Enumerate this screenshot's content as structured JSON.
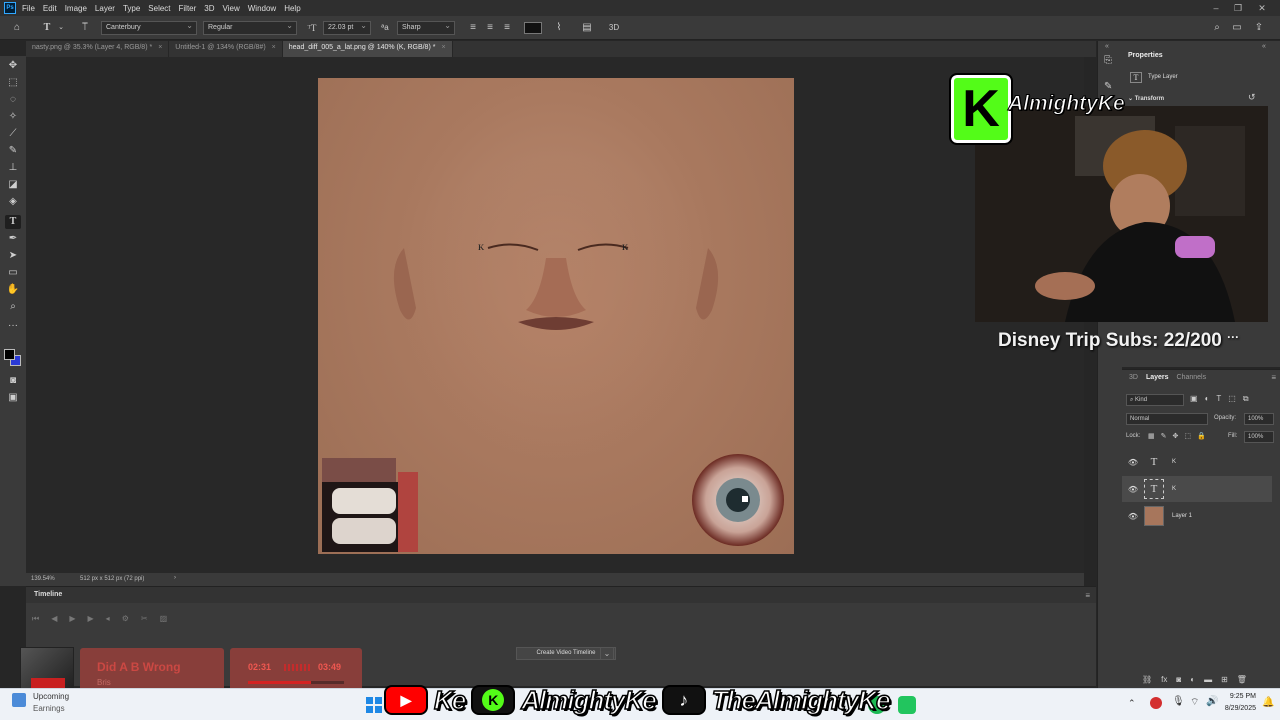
{
  "menubar": {
    "items": [
      "File",
      "Edit",
      "Image",
      "Layer",
      "Type",
      "Select",
      "Filter",
      "3D",
      "View",
      "Window",
      "Help"
    ]
  },
  "options": {
    "font_family": "Canterbury",
    "font_style": "Regular",
    "font_size": "22.03 pt",
    "antialias": "Sharp",
    "threed_label": "3D"
  },
  "tabs": [
    {
      "label": "nasty.png @ 35.3% (Layer 4, RGB/8) *",
      "active": false
    },
    {
      "label": "Untitled-1 @ 134% (RGB/8#)",
      "active": false
    },
    {
      "label": "head_diff_005_a_lat.png @ 140% (K, RGB/8) *",
      "active": true
    }
  ],
  "status": {
    "zoom": "139.54%",
    "doc_info": "512 px x 512 px (72 ppi)",
    "arrow": "›"
  },
  "timeline": {
    "title": "Timeline",
    "create_button": "Create Video Timeline"
  },
  "properties": {
    "title": "Properties",
    "type_layer": "Type Layer",
    "transform": "Transform"
  },
  "layers_panel": {
    "tabs": [
      "3D",
      "Layers",
      "Channels"
    ],
    "active_tab": "Layers",
    "kind_label": "Kind",
    "blend_mode": "Normal",
    "opacity_label": "Opacity:",
    "opacity_value": "100%",
    "lock_label": "Lock:",
    "fill_label": "Fill:",
    "fill_value": "100%",
    "layers": [
      {
        "name": "K",
        "type": "text",
        "selected": false,
        "thumb": "T"
      },
      {
        "name": "K",
        "type": "text",
        "selected": true,
        "thumb": "T"
      },
      {
        "name": "Layer 1",
        "type": "image",
        "selected": false,
        "thumb": ""
      }
    ]
  },
  "overlay": {
    "logo_letter": "K",
    "logo_name": "AlmightyKe",
    "subs_text": "Disney Trip Subs: 22/200",
    "subs_dots": "···"
  },
  "music": {
    "song": "Did A B Wrong",
    "artist": "Bris",
    "elapsed": "02:31",
    "total": "03:49",
    "progress": 0.66
  },
  "social": {
    "youtube_name": "Ke",
    "kick_name": "AlmightyKe",
    "tiktok_name": "TheAlmightyKe"
  },
  "taskbar": {
    "time": "9:25 PM",
    "date": "8/29/2025",
    "widget_line1": "Upcoming",
    "widget_line2": "Earnings"
  },
  "colors": {
    "accent_green": "#53fc18",
    "ps_blue": "#31a8ff",
    "music_red": "#c83232",
    "youtube_red": "#ff0000"
  }
}
